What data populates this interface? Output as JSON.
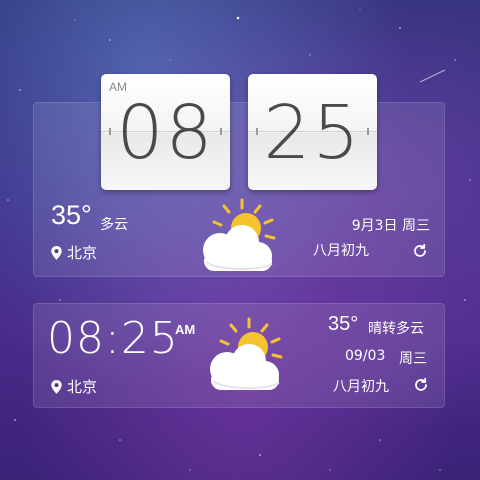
{
  "clock": {
    "ampm": "AM",
    "hours": "08",
    "minutes": "25"
  },
  "widget_top": {
    "temperature": "35°",
    "condition": "多云",
    "location": "北京",
    "date": "9月3日 周三",
    "lunar": "八月初九",
    "location_icon": "location-pin-icon",
    "refresh_icon": "refresh-icon",
    "weather_icon": "partly-cloudy-icon"
  },
  "widget_bottom": {
    "time": "08:25",
    "ampm": "AM",
    "temperature": "35°",
    "condition": "晴转多云",
    "date": "09/03",
    "weekday": "周三",
    "location": "北京",
    "lunar": "八月初九",
    "location_icon": "location-pin-icon",
    "refresh_icon": "refresh-icon",
    "weather_icon": "partly-cloudy-icon"
  },
  "colors": {
    "sun": "#f5c330",
    "cloud": "#ffffff",
    "text": "#ffffff",
    "digits": "#4a4a4a"
  }
}
